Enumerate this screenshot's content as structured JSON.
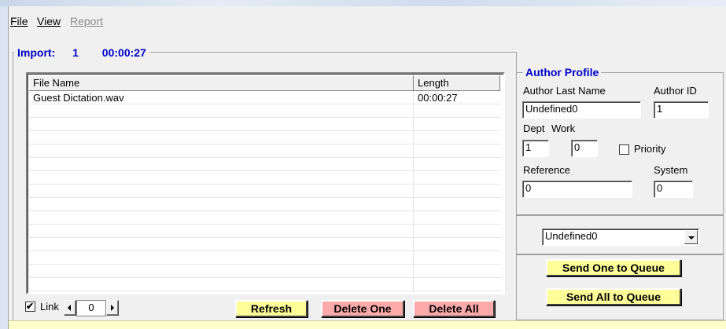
{
  "menu": {
    "file": "File",
    "view": "View",
    "report": "Report"
  },
  "import": {
    "label": "Import:",
    "count": "1",
    "duration": "00:00:27"
  },
  "file_list": {
    "columns": [
      "File Name",
      "Length"
    ],
    "rows": [
      {
        "name": "Guest Dictation.wav",
        "length": "00:00:27"
      }
    ]
  },
  "link": {
    "label": "Link",
    "checked": true,
    "value": "0"
  },
  "buttons": {
    "refresh": "Refresh",
    "delete_one": "Delete One",
    "delete_all": "Delete All",
    "send_one": "Send One to Queue",
    "send_all": "Send All to Queue"
  },
  "author_profile": {
    "title": "Author Profile",
    "last_name_label": "Author Last Name",
    "last_name": "Undefined0",
    "id_label": "Author ID",
    "id": "1",
    "dept_label": "Dept",
    "dept": "1",
    "work_label": "Work",
    "work": "0",
    "priority_label": "Priority",
    "priority_checked": false,
    "reference_label": "Reference",
    "reference": "0",
    "system_label": "System",
    "system": "0"
  },
  "author_select": {
    "selected": "Undefined0"
  }
}
